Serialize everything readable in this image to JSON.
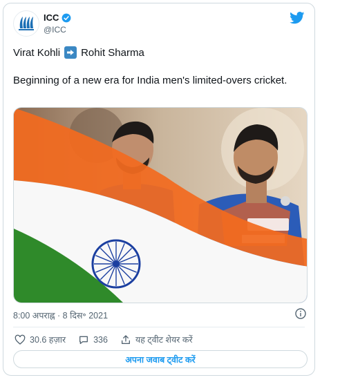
{
  "tweet": {
    "author_name": "ICC",
    "handle": "@ICC",
    "line1_left": "Virat Kohli",
    "line1_right": "Rohit Sharma",
    "body": "Beginning of a new era for India men's limited-overs cricket.",
    "timestamp": "8:00 अपराह्न · 8 दिस॰ 2021",
    "likes": "30.6 हज़ार",
    "replies": "336",
    "share_label": "यह ट्वीट शेयर करें",
    "reply_label": "अपना जवाब ट्वीट करें"
  },
  "colors": {
    "twitter_blue": "#1d9bf0",
    "verified": "#1d9bf0",
    "flag_saffron": "#f26a1f",
    "flag_green": "#2f8a2a",
    "chakra_blue": "#1b3fa0",
    "jersey_blue": "#2b5cb8"
  },
  "icons": {
    "avatar": "icc-logo",
    "verified": "verified-badge-icon",
    "brand": "twitter-bird-icon",
    "arrow": "right-arrow-emoji",
    "info": "info-icon",
    "like": "heart-icon",
    "reply": "reply-bubble-icon",
    "share": "share-icon"
  }
}
